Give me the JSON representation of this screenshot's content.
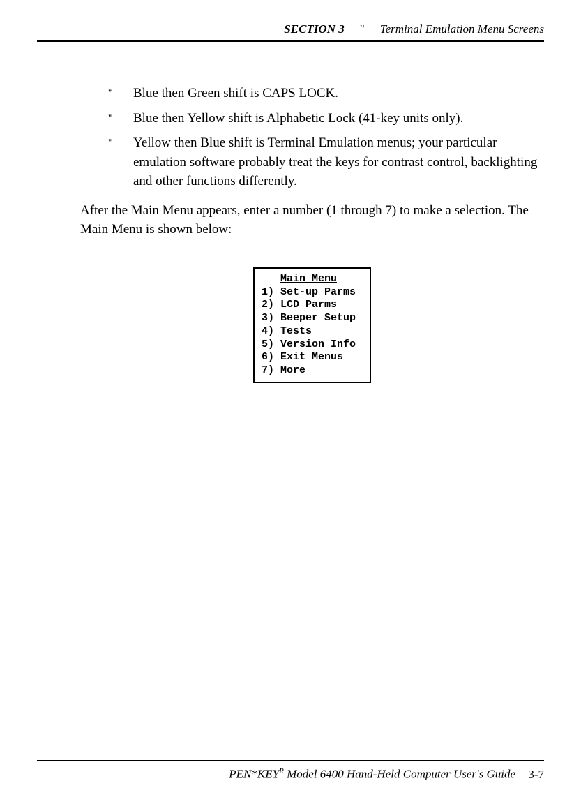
{
  "header": {
    "section": "SECTION 3",
    "bullet": "\"",
    "title": "Terminal Emulation Menu Screens"
  },
  "bullets": [
    "Blue then Green shift is CAPS LOCK.",
    "Blue then Yellow shift is Alphabetic Lock (41-key units only).",
    "Yellow then Blue shift is Terminal Emulation menus; your particular emulation software probably treat the keys for contrast control, backlighting and other functions differently."
  ],
  "bullet_marker": "\"",
  "paragraph": "After the Main Menu appears, enter a number (1 through 7) to make a selection. The Main Menu is shown below:",
  "menu": {
    "title": "Main Menu",
    "items": [
      "1) Set-up Parms",
      "2) LCD Parms",
      "3) Beeper Setup",
      "4) Tests",
      "5) Version Info",
      "6) Exit Menus",
      "7) More"
    ]
  },
  "footer": {
    "product": "PEN*KEY",
    "sup": "R",
    "rest": " Model 6400 Hand-Held Computer User's Guide",
    "page": "3-7"
  }
}
